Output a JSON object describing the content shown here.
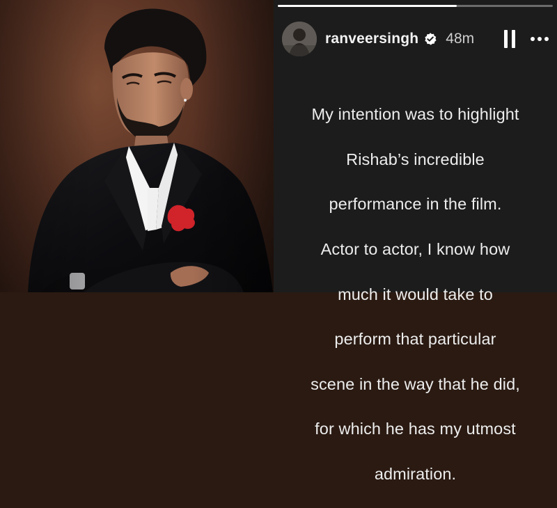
{
  "photo": {
    "subject": "man in black velvet suit with red pocket square, arms crossed"
  },
  "story": {
    "progress_fraction": 0.65,
    "user": {
      "username": "ranveersingh",
      "verified": true,
      "timestamp": "48m"
    },
    "controls": {
      "pause_icon": "pause-icon",
      "more_icon": "more-options-icon"
    },
    "caption_lines": [
      "My intention was to highlight",
      "Rishab’s incredible",
      "performance in the film.",
      "Actor to actor, I know how",
      "much it would take to",
      "perform that particular",
      "scene in the way that he did,",
      "for which he has my utmost",
      "admiration."
    ]
  },
  "colors": {
    "story_bg": "#1c1c1c",
    "text": "#ededed",
    "verified_badge": "#ffffff",
    "pocket_square": "#d0232a"
  }
}
